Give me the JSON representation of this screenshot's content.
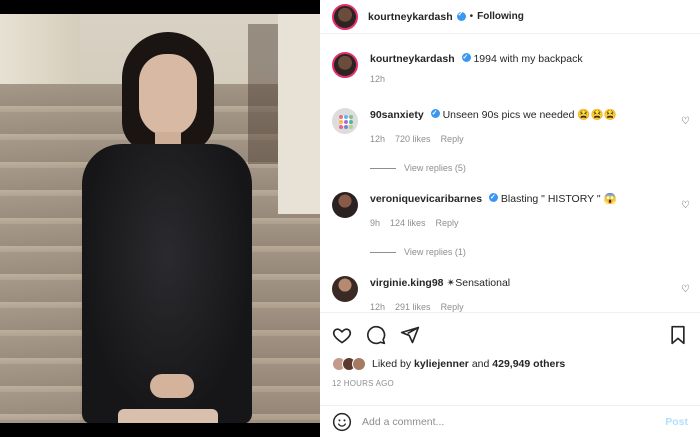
{
  "post": {
    "username": "kourtneykardash",
    "follow_state": "Following",
    "dot": "•"
  },
  "caption": {
    "username": "kourtneykardash",
    "text": "1994 with my backpack",
    "time": "12h"
  },
  "comments": [
    {
      "username": "90sanxiety",
      "text": "Unseen 90s pics we needed 😫😫😫",
      "time": "12h",
      "likes": "720 likes",
      "reply": "Reply",
      "view_replies": "View replies (5)",
      "verified": true
    },
    {
      "username": "veroniquevicaribarnes",
      "text": "Blasting \" HISTORY \" 😱",
      "time": "9h",
      "likes": "124 likes",
      "reply": "Reply",
      "view_replies": "View replies (1)",
      "verified": true
    },
    {
      "username": "virginie.king98",
      "text": "✴Sensational",
      "time": "12h",
      "likes": "291 likes",
      "reply": "Reply",
      "verified": false
    }
  ],
  "likes_line": {
    "prefix": "Liked by",
    "user": "kyliejenner",
    "middle": "and",
    "count": "429,949 others"
  },
  "timestamp": "12 HOURS AGO",
  "add_comment": {
    "placeholder": "Add a comment...",
    "post_label": "Post"
  },
  "colors": {
    "verified": "#3897f0",
    "story_ring": "#e1306c",
    "post_disabled": "#b2dffc"
  }
}
